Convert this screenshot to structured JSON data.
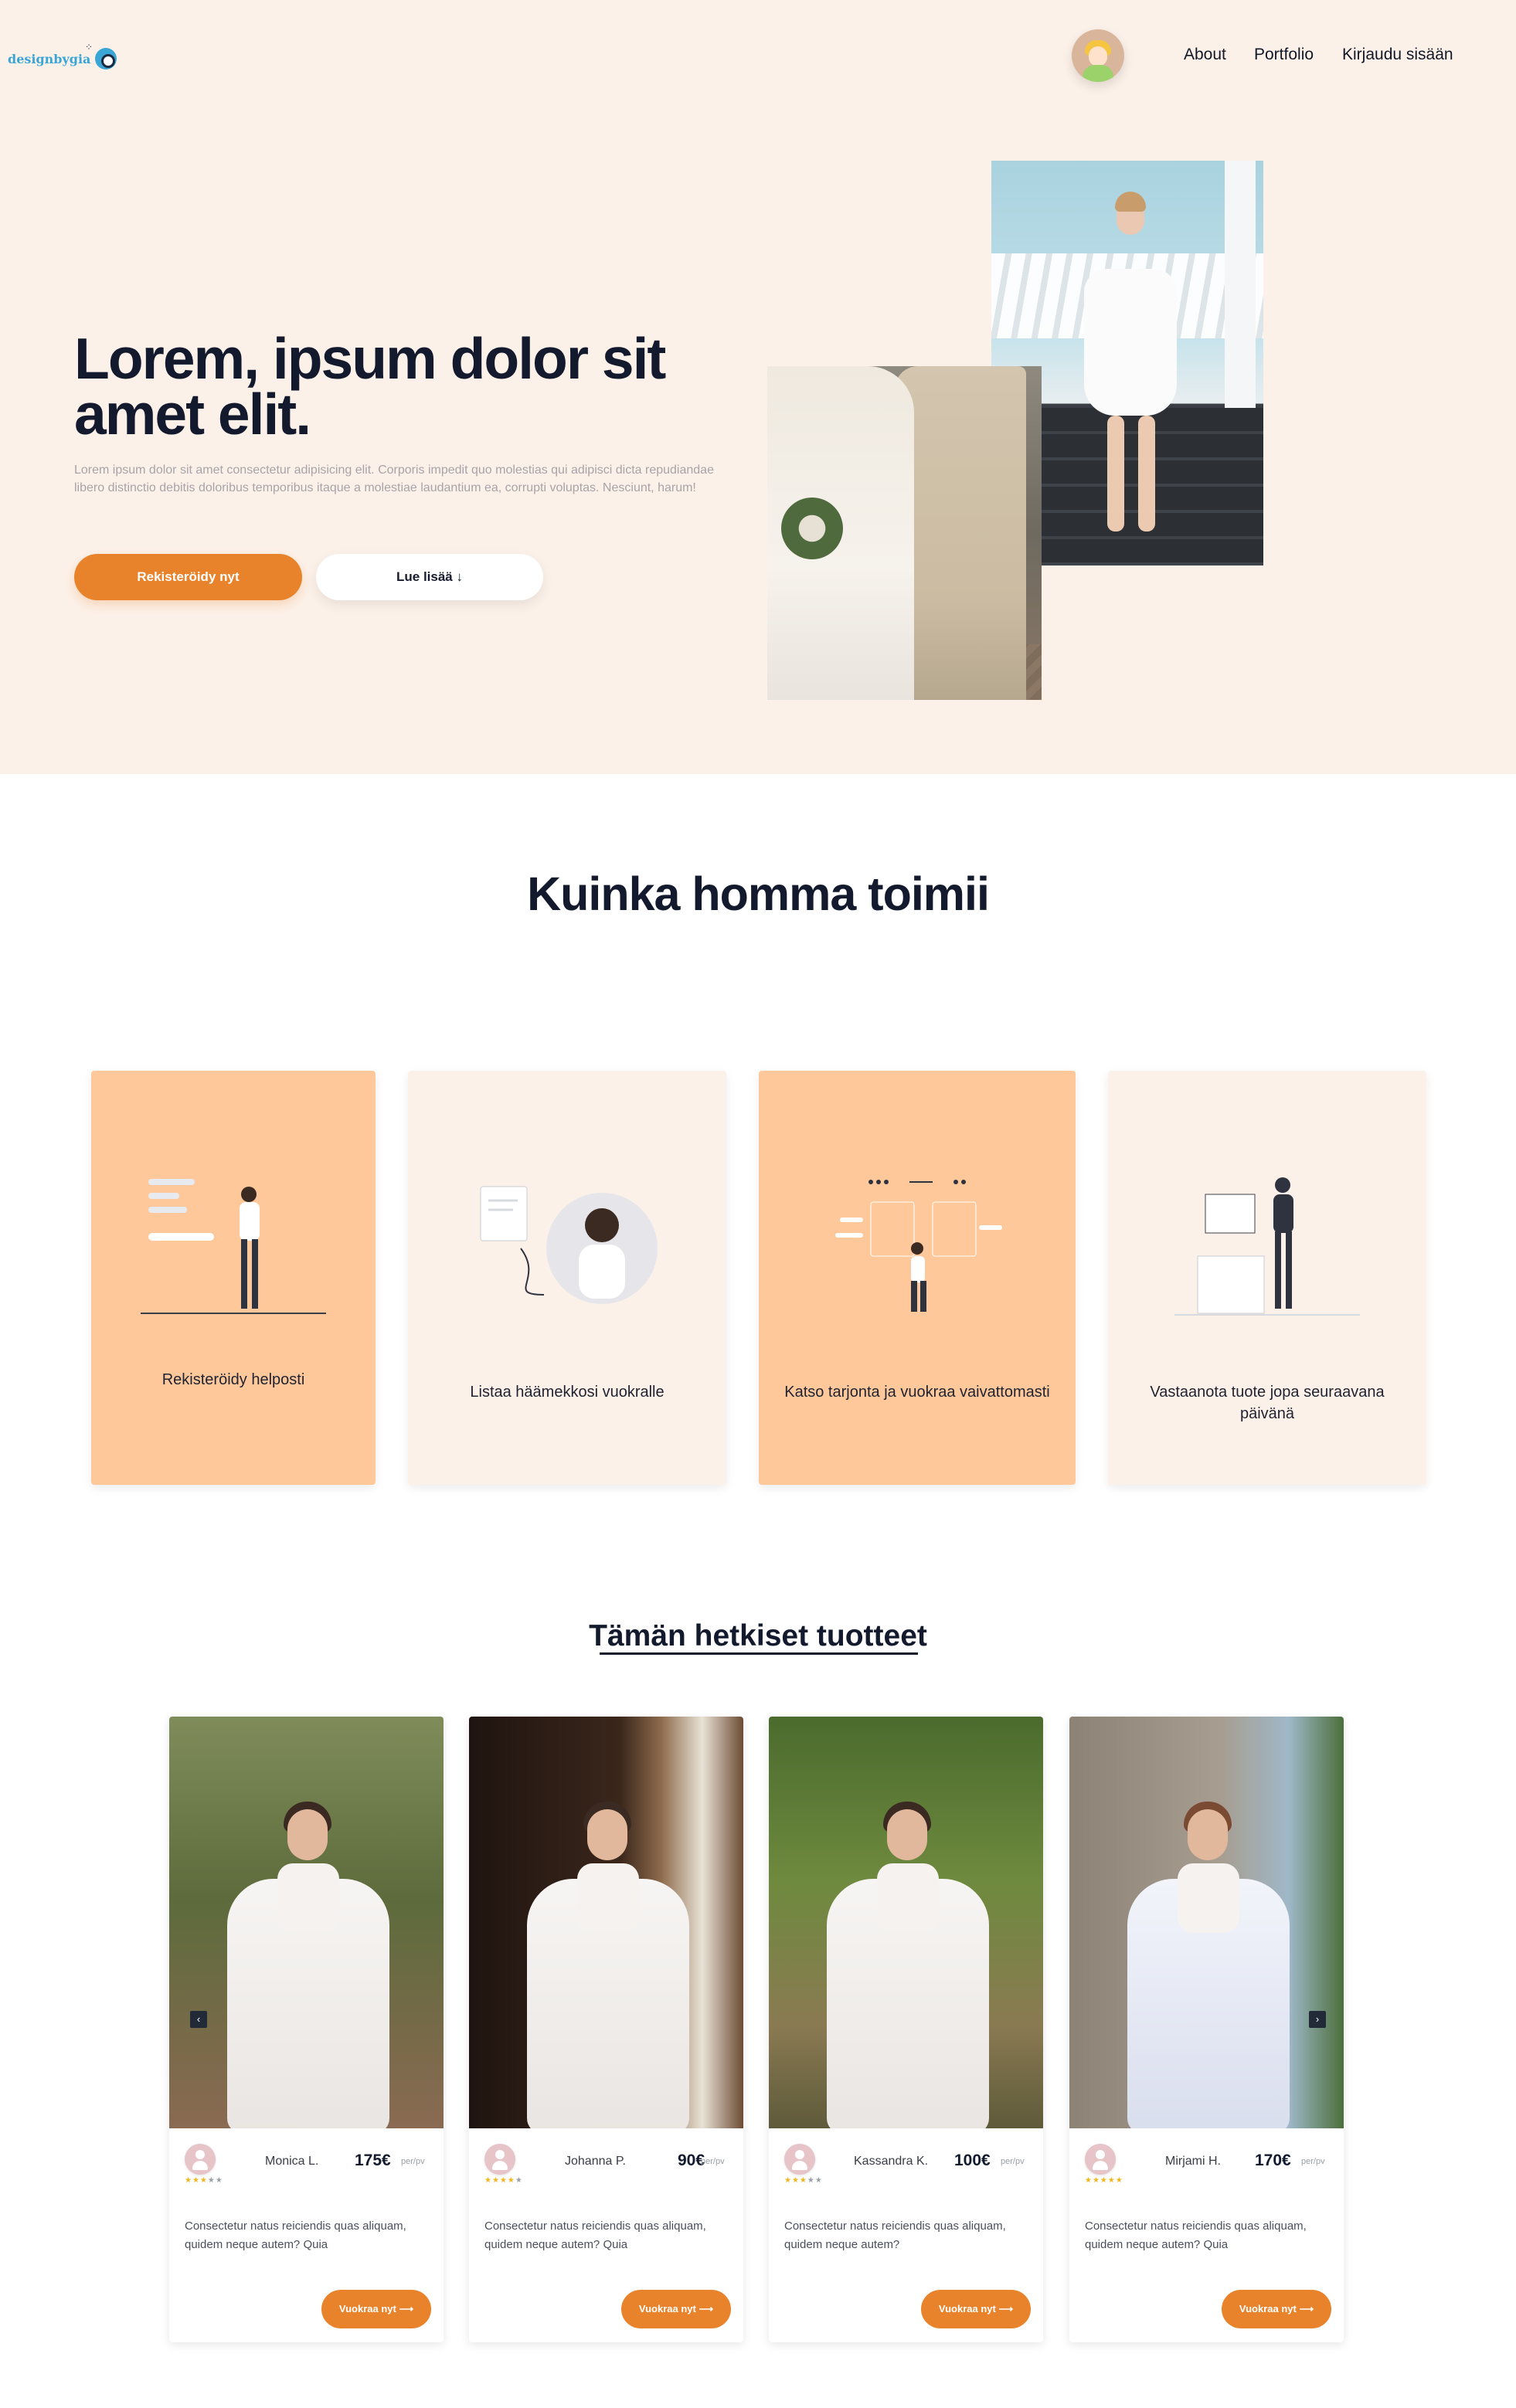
{
  "header": {
    "logo_text": "designbygia",
    "nav": [
      "About",
      "Portfolio",
      "Kirjaudu sisään"
    ]
  },
  "hero": {
    "title_line1": "Lorem, ipsum dolor sit",
    "title_line2": "amet elit.",
    "subtitle": "Lorem ipsum dolor sit amet consectetur adipisicing elit. Corporis impedit quo molestias qui adipisci dicta repudiandae libero distinctio debitis doloribus temporibus itaque a molestiae laudantium ea, corrupti voluptas. Nesciunt, harum!",
    "primary_button": "Rekisteröidy nyt",
    "secondary_button": "Lue lisää ↓"
  },
  "how": {
    "title": "Kuinka homma toimii",
    "steps": [
      {
        "label": "Rekisteröidy helposti"
      },
      {
        "label": "Listaa häämekkosi vuokralle"
      },
      {
        "label": "Katso tarjonta ja vuokraa vaivattomasti"
      },
      {
        "label": "Vastaanota tuote jopa seuraavana päivänä"
      }
    ]
  },
  "products": {
    "title": "Tämän hetkiset tuotteet",
    "items": [
      {
        "seller": "Monica L.",
        "price": "175€",
        "per": "per/pv",
        "rating": 3,
        "description": "Consectetur natus reiciendis quas aliquam, quidem neque autem? Quia",
        "button": "Vuokraa nyt ⟶"
      },
      {
        "seller": "Johanna P.",
        "price": "90€",
        "per": "per/pv",
        "rating": 4,
        "description": "Consectetur natus reiciendis quas aliquam, quidem neque autem? Quia",
        "button": "Vuokraa nyt ⟶"
      },
      {
        "seller": "Kassandra K.",
        "price": "100€",
        "per": "per/pv",
        "rating": 3,
        "description": "Consectetur natus reiciendis quas aliquam, quidem neque autem?",
        "button": "Vuokraa nyt ⟶"
      },
      {
        "seller": "Mirjami H.",
        "price": "170€",
        "per": "per/pv",
        "rating": 5,
        "description": "Consectetur natus reiciendis quas aliquam, quidem neque autem? Quia",
        "button": "Vuokraa nyt ⟶"
      }
    ],
    "prev_arrow": "‹",
    "next_arrow": "›"
  },
  "colors": {
    "accent": "#e9832b",
    "hero_bg": "#fcf1e9",
    "card_peach": "#fec89b",
    "text_dark": "#141a2e"
  }
}
